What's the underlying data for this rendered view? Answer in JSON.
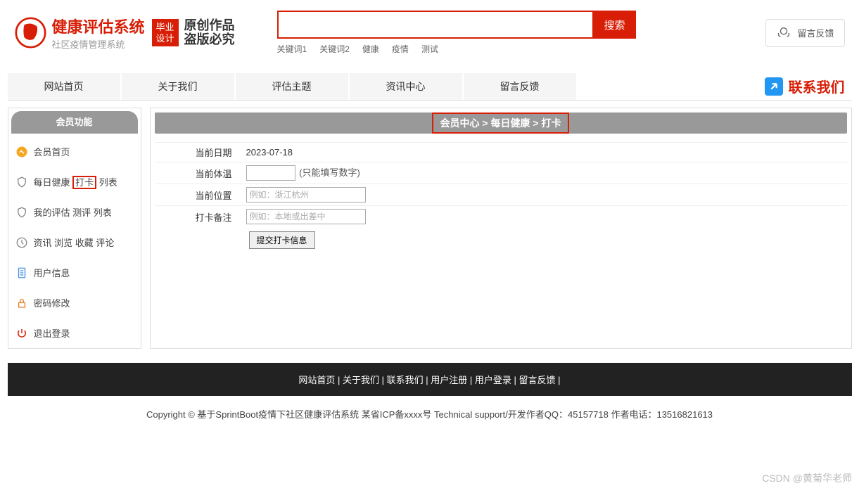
{
  "header": {
    "title": "健康评估系统",
    "subtitle": "社区疫情管理系统",
    "badge_line1": "毕业",
    "badge_line2": "设计",
    "slogan_line1": "原创作品",
    "slogan_line2": "盗版必究",
    "search_button": "搜索",
    "keywords": [
      "关键词1",
      "关键词2",
      "健康",
      "疫情",
      "测试"
    ],
    "feedback": "留言反馈"
  },
  "nav": {
    "items": [
      "网站首页",
      "关于我们",
      "评估主题",
      "资讯中心",
      "留言反馈"
    ],
    "contact": "联系我们"
  },
  "sidebar": {
    "header": "会员功能",
    "items": [
      {
        "icon": "home-icon",
        "label": "会员首页"
      },
      {
        "icon": "shield-icon",
        "label_pre": "每日健康 ",
        "label_boxed": "打卡",
        "label_post": " 列表"
      },
      {
        "icon": "shield-icon",
        "label": "我的评估 测评 列表"
      },
      {
        "icon": "clock-icon",
        "label": "资讯 浏览 收藏 评论"
      },
      {
        "icon": "doc-icon",
        "label": "用户信息"
      },
      {
        "icon": "lock-icon",
        "label": "密码修改"
      },
      {
        "icon": "power-icon",
        "label": "退出登录"
      }
    ]
  },
  "breadcrumb": "会员中心 > 每日健康 > 打卡",
  "form": {
    "rows": [
      {
        "label": "当前日期",
        "value": "2023-07-18"
      },
      {
        "label": "当前体温",
        "hint": "(只能填写数字)"
      },
      {
        "label": "当前位置",
        "placeholder": "例如：浙江杭州"
      },
      {
        "label": "打卡备注",
        "placeholder": "例如：本地或出差中"
      }
    ],
    "submit": "提交打卡信息"
  },
  "footer": {
    "nav_items": [
      "网站首页",
      "关于我们",
      "联系我们",
      "用户注册",
      "用户登录",
      "留言反馈"
    ],
    "copyright": "Copyright © 基于SprintBoot疫情下社区健康评估系统   某省ICP备xxxx号    Technical support/开发作者QQ：45157718     作者电话：13516821613"
  },
  "watermark": "CSDN @黄菊华老师"
}
